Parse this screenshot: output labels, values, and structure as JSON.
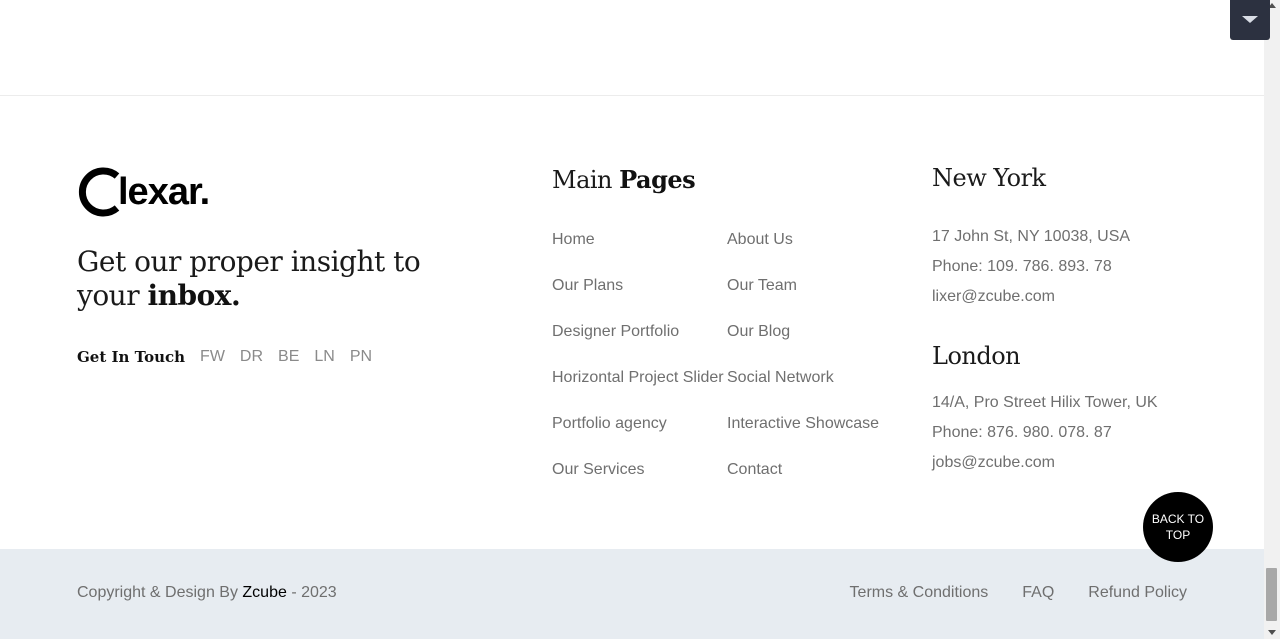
{
  "brand": {
    "logo_text": "lexar.",
    "logo_icon": "c-ring-logo"
  },
  "tagline": {
    "line1": "Get our proper insight to",
    "line2_prefix": "your ",
    "line2_bold": "inbox."
  },
  "contact": {
    "label": "Get In Touch",
    "socials": [
      "FW",
      "DR",
      "BE",
      "LN",
      "PN"
    ]
  },
  "main_pages": {
    "heading_light": "Main ",
    "heading_bold": "Pages",
    "left": [
      "Home",
      "Our Plans",
      "Designer Portfolio",
      "Horizontal Project Slider",
      "Portfolio agency",
      "Our Services"
    ],
    "right": [
      "About Us",
      "Our Team",
      "Our Blog",
      "Social Network",
      "Interactive Showcase",
      "Contact"
    ]
  },
  "offices": {
    "new_york": {
      "title": "New York",
      "address": "17 John St, NY 10038, USA",
      "phone": "Phone: 109. 786. 893. 78",
      "email": "lixer@zcube.com"
    },
    "london": {
      "title": "London",
      "address": "14/A, Pro Street Hilix Tower, UK",
      "phone": "Phone: 876. 980. 078. 87",
      "email": "jobs@zcube.com"
    }
  },
  "back_to_top": "BACK TO TOP",
  "footer": {
    "copyright_prefix": "Copyright & Design By ",
    "copyright_brand": "Zcube",
    "copyright_suffix": " - 2023",
    "links": [
      "Terms & Conditions",
      "FAQ",
      "Refund Policy"
    ]
  },
  "colors": {
    "bottom_bar": "#e7ecf1",
    "dropdown": "#2c3140",
    "accent": "#000000"
  }
}
